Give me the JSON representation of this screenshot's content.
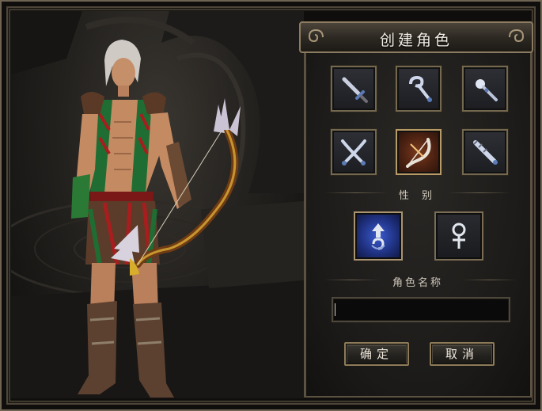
{
  "panel": {
    "title": "创建角色",
    "classes": [
      {
        "icon": "sword-icon",
        "selected": false
      },
      {
        "icon": "staff-hook-icon",
        "selected": false
      },
      {
        "icon": "magic-wand-icon",
        "selected": false
      },
      {
        "icon": "crossed-daggers-icon",
        "selected": false
      },
      {
        "icon": "bow-icon",
        "selected": true
      },
      {
        "icon": "scepter-icon",
        "selected": false
      }
    ],
    "gender_label": "性 别",
    "genders": [
      {
        "icon": "male-symbol-icon",
        "selected": true
      },
      {
        "icon": "female-symbol-icon",
        "selected": false
      }
    ],
    "name_label": "角色名称",
    "name_value": "",
    "confirm_label": "确定",
    "cancel_label": "取消"
  },
  "colors": {
    "frame": "#6f6452",
    "selected_class": "#7a3a1c",
    "selected_gender": "#3a5bd1",
    "text": "#f2ede4"
  }
}
